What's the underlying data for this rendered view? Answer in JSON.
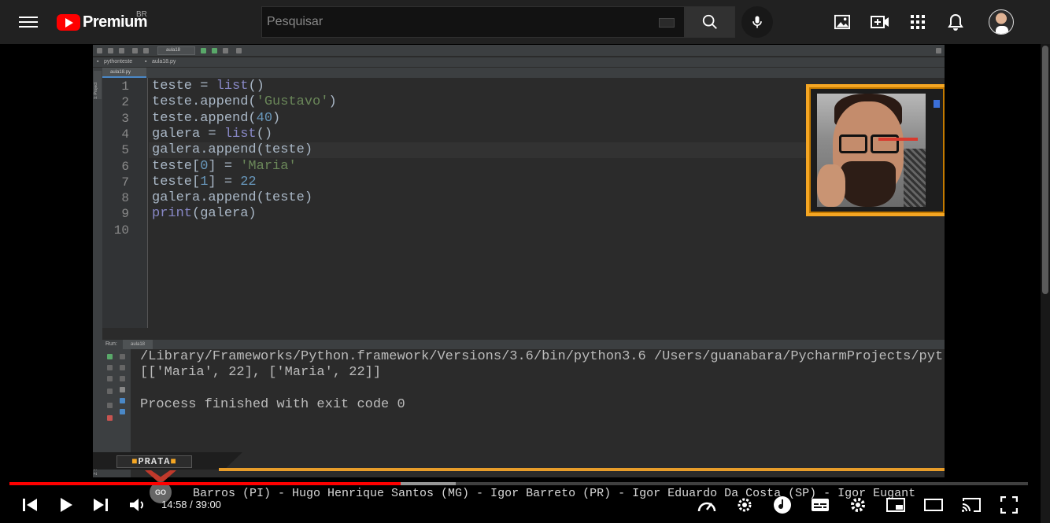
{
  "header": {
    "brand": "Premium",
    "country": "BR",
    "search_placeholder": "Pesquisar"
  },
  "ide": {
    "run_config": "aula18",
    "project": "pythonteste",
    "file_breadcrumb": "aula18.py",
    "tab_label": "aula18.py",
    "gutter_labels": [
      "1: Project",
      "Z: Structure"
    ],
    "code_lines": [
      "teste = list()",
      "teste.append('Gustavo')",
      "teste.append(40)",
      "galera = list()",
      "galera.append(teste)",
      "teste[0] = 'Maria'",
      "teste[1] = 22",
      "galera.append(teste)",
      "print(galera)",
      ""
    ],
    "line_numbers": [
      "1",
      "2",
      "3",
      "4",
      "5",
      "6",
      "7",
      "8",
      "9",
      "10"
    ],
    "run_label": "Run:",
    "run_tab": "aula18",
    "output_lines": [
      "/Library/Frameworks/Python.framework/Versions/3.6/bin/python3.6 /Users/guanabara/PycharmProjects/pyt",
      "[['Maria', 22], ['Maria', 22]]",
      "",
      "Process finished with exit code 0"
    ]
  },
  "overlay": {
    "tier_label": "PRATA",
    "tier_bullet": "■",
    "go_badge": "GO",
    "ticker": "Barros (PI) - Hugo Henrique Santos (MG) - Igor Barreto (PR) - Igor Eduardo Da Costa (SP) - Igor Eugant"
  },
  "player": {
    "current_time": "14:58",
    "duration": "39:00",
    "time_display": "14:58 / 39:00",
    "played_fraction": 0.384,
    "loaded_fraction": 0.438
  },
  "colors": {
    "youtube_red": "#ff0000",
    "accent_orange": "#f5a623"
  }
}
